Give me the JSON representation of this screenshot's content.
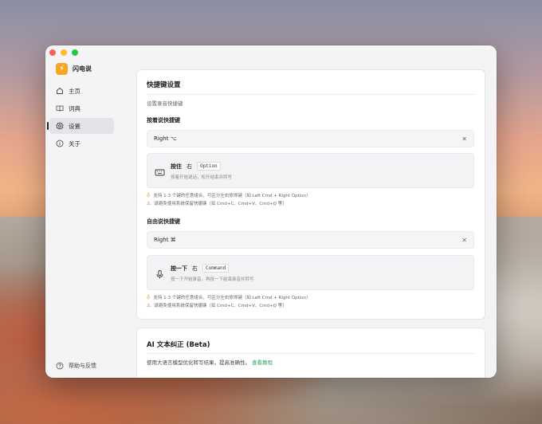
{
  "app": {
    "name": "闪电说"
  },
  "sidebar": {
    "items": [
      {
        "label": "主页",
        "icon": "home-icon"
      },
      {
        "label": "词典",
        "icon": "book-icon"
      },
      {
        "label": "设置",
        "icon": "gear-icon",
        "active": true
      },
      {
        "label": "关于",
        "icon": "info-icon"
      }
    ],
    "help_label": "帮助与反馈"
  },
  "shortcuts": {
    "title": "快捷键设置",
    "subtitle": "设置录音快捷键",
    "hold": {
      "label": "按着说快捷键",
      "value": "Right ⌥",
      "action": "按住",
      "key_prefix": "右",
      "key_name": "Option",
      "desc": "按着开始说话，松开结束并转写",
      "tip": "支持 1-3 个键的任意组合，可区分左右修饰键（如 Left Cmd + Right Option）",
      "warning": "请避免使用系统保留快捷键（如 Cmd+C、Cmd+V、Cmd+Q 等）"
    },
    "free": {
      "label": "自由说快捷键",
      "value": "Right ⌘",
      "action": "按一下",
      "key_prefix": "右",
      "key_name": "Command",
      "desc": "按一下开始录音，再按一下结束录音并转写",
      "tip": "支持 1-3 个键的任意组合，可区分左右修饰键（如 Left Cmd + Right Option）",
      "warning": "请避免使用系统保留快捷键（如 Cmd+C、Cmd+V、Cmd+Q 等）"
    }
  },
  "ai": {
    "title": "AI 文本纠正 (Beta)",
    "desc": "使用大语言模型优化转写结果，提高准确性。",
    "link": "查看教程"
  },
  "colors": {
    "accent": "#f5a623",
    "link": "#2a9d5b"
  }
}
